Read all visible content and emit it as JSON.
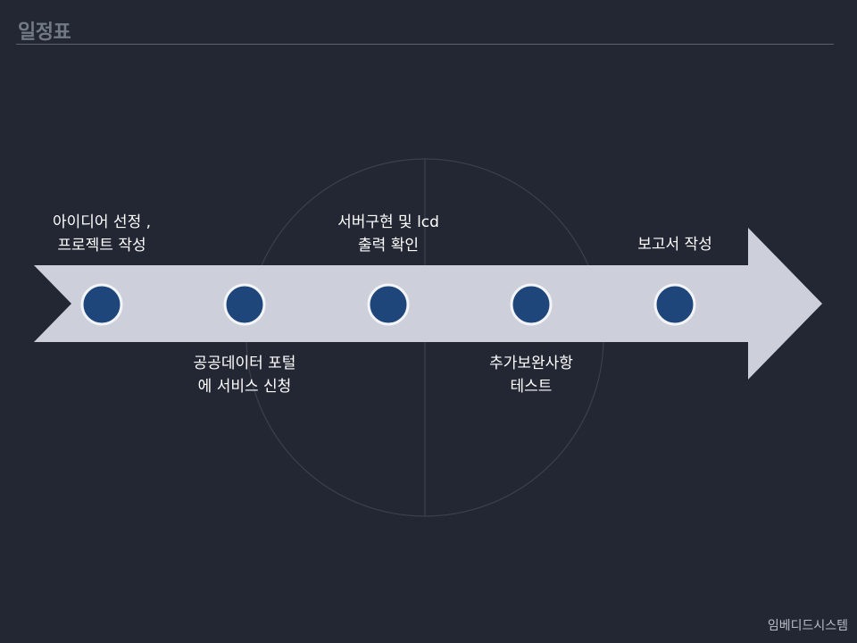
{
  "slide": {
    "title": "일정표",
    "footer": "임베디드시스템"
  },
  "timeline": {
    "milestones": [
      {
        "line1": "아이디어 선정 ,",
        "line2": "프로젝트 작성"
      },
      {
        "line1": "공공데이터 포털",
        "line2": "에 서비스 신청"
      },
      {
        "line1": "서버구현 및 lcd",
        "line2": "출력 확인"
      },
      {
        "line1": "추가보완사항",
        "line2": "테스트"
      },
      {
        "line1": "보고서 작성",
        "line2": ""
      }
    ]
  },
  "colors": {
    "background": "#222733",
    "arrow": "#cdd0da",
    "node_fill": "#1e467a",
    "node_ring": "#f3f4f7",
    "text": "#ffffff"
  }
}
